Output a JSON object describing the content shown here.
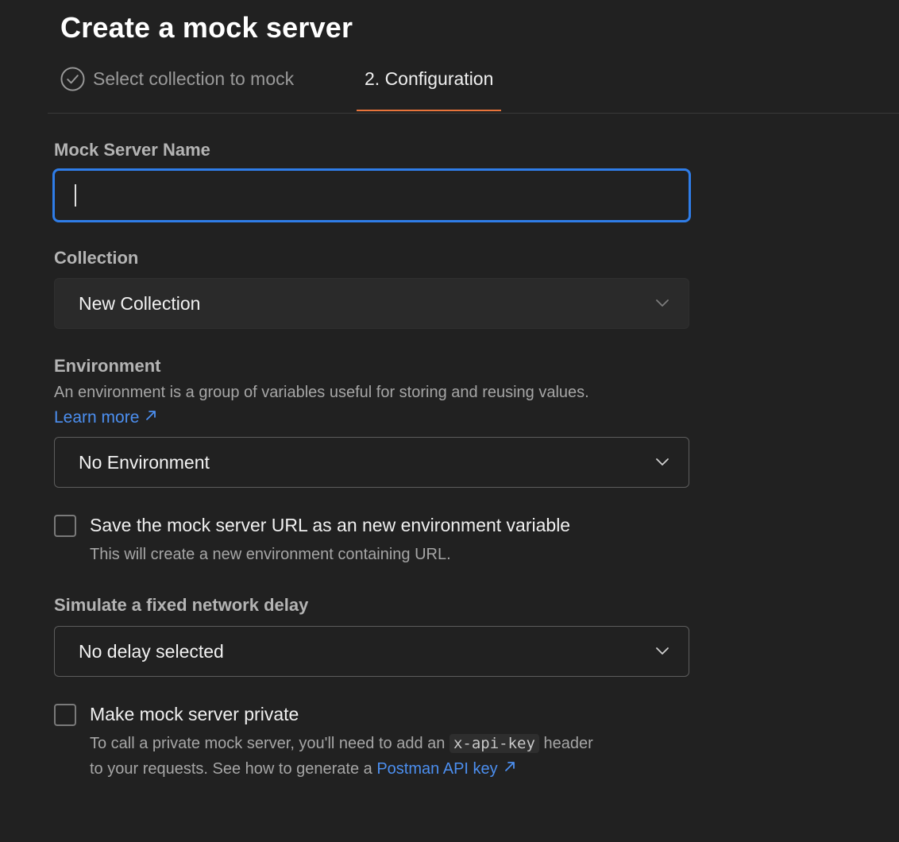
{
  "header": {
    "title": "Create a mock server"
  },
  "steps": {
    "step1_label": "Select collection to mock",
    "step2_label": "2. Configuration"
  },
  "mock_name": {
    "label": "Mock Server Name",
    "value": ""
  },
  "collection": {
    "label": "Collection",
    "selected": "New Collection"
  },
  "environment": {
    "label": "Environment",
    "description": "An environment is a group of variables useful for storing and reusing values.",
    "learn_more": "Learn more",
    "selected": "No Environment"
  },
  "save_url": {
    "label": "Save the mock server URL as an new environment variable",
    "description": "This will create a new environment containing URL.",
    "checked": false
  },
  "delay": {
    "label": "Simulate a fixed network delay",
    "selected": "No delay selected"
  },
  "private": {
    "label": "Make mock server private",
    "desc_part1": "To call a private mock server, you'll need to add an",
    "code": "x-api-key",
    "desc_part2": "header",
    "desc_line2": "to your requests. See how to generate a",
    "link": "Postman API key",
    "checked": false
  },
  "colors": {
    "background": "#212121",
    "accent_tab": "#e8743b",
    "focus_border": "#2f7de8",
    "link": "#4c8ff0"
  }
}
